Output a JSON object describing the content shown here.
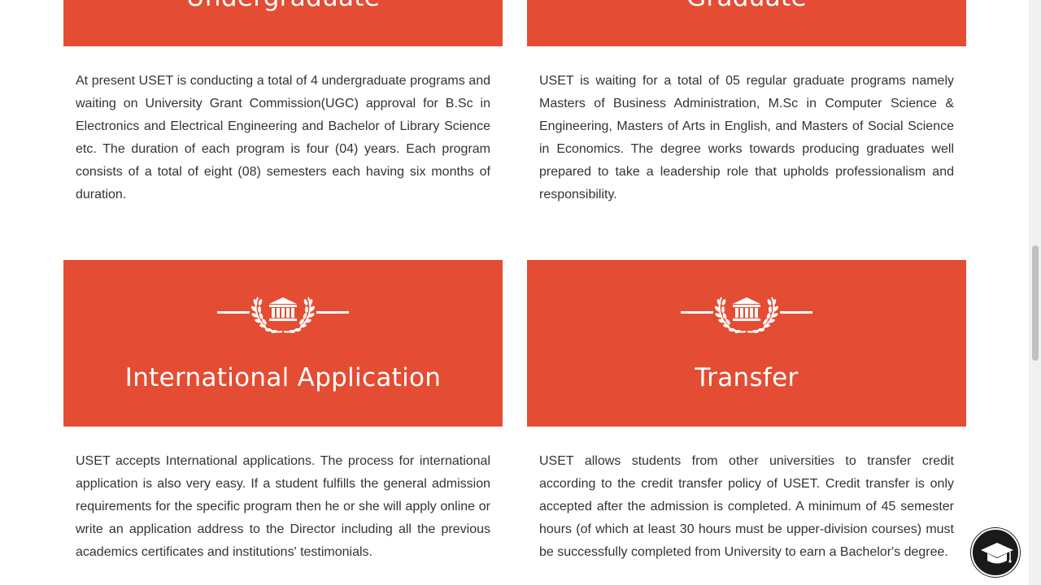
{
  "colors": {
    "accent": "#e44c33",
    "text": "#333333",
    "background": "#ffffff"
  },
  "cards": {
    "undergraduate": {
      "title": "Undergraduate",
      "body": "At present USET is conducting a total of 4 undergraduate programs and waiting on University Grant Commission(UGC) approval for B.Sc in Electronics and Electrical Engineering and Bachelor of Library Science etc. The duration of each program is four (04) years. Each program consists of a total of eight (08) semesters each having six months of duration."
    },
    "graduate": {
      "title": "Graduate",
      "body": "USET is waiting for a total of 05 regular graduate programs namely Masters of Business Administration, M.Sc in Computer Science & Engineering, Masters of Arts in English, and Masters of Social Science in Economics. The degree works towards producing graduates well prepared to take a leadership role that upholds professionalism and responsibility."
    },
    "international": {
      "title": "International Application",
      "icon": "university-laurel-icon",
      "body": "USET accepts International applications. The process for international application is also very easy. If a student fulfills the general admission requirements for the specific program then he or she will apply online or write an application address to the Director including all the previous academics certificates and institutions' testimonials."
    },
    "transfer": {
      "title": "Transfer",
      "icon": "university-laurel-icon",
      "body": "USET allows students from other universities to transfer credit according to the credit transfer policy of USET. Credit transfer is only accepted after the admission is completed. A minimum of 45 semester hours (of which at least 30 hours must be upper-division courses) must be successfully completed from University to earn a Bachelor's degree."
    }
  },
  "floating_button": {
    "icon": "graduation-cap-icon"
  }
}
